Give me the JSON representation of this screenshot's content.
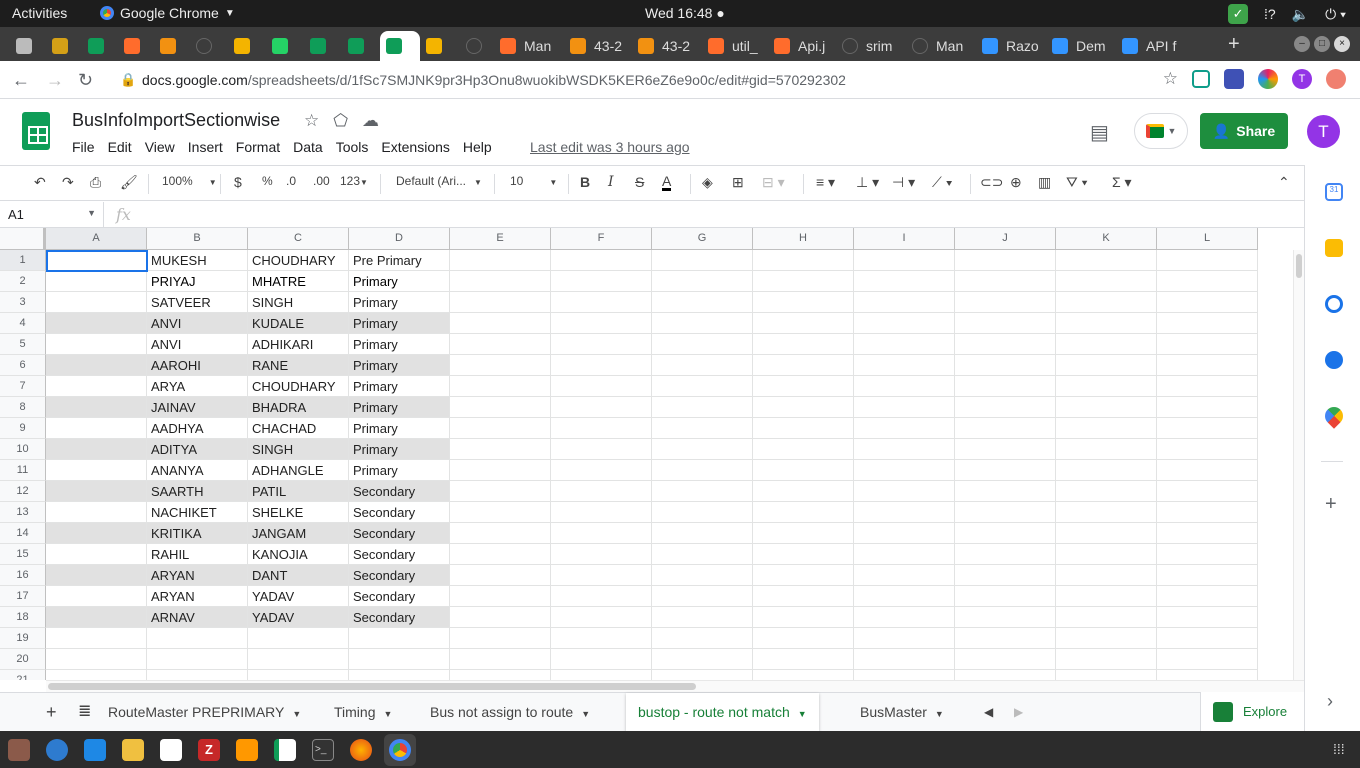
{
  "system": {
    "activities": "Activities",
    "app_name": "Google Chrome",
    "clock": "Wed 16:48 ●"
  },
  "tabs": [
    {
      "label": "",
      "icon": "globe-icon",
      "color": "#bbbbbb"
    },
    {
      "label": "",
      "icon": "moon-icon",
      "color": "#d4a017"
    },
    {
      "label": "",
      "icon": "sheets-icon",
      "color": "#0f9d58"
    },
    {
      "label": "",
      "icon": "cpanel-icon",
      "color": "#ff6c2c"
    },
    {
      "label": "",
      "icon": "pma-icon",
      "color": "#f29111"
    },
    {
      "label": "",
      "icon": "blank-icon",
      "color": "#555555"
    },
    {
      "label": "",
      "icon": "one-icon",
      "color": "#f4b400"
    },
    {
      "label": "",
      "icon": "whatsapp-icon",
      "color": "#25d366"
    },
    {
      "label": "",
      "icon": "sheets-icon",
      "color": "#0f9d58"
    },
    {
      "label": "",
      "icon": "sheets-icon",
      "color": "#0f9d58"
    },
    {
      "label": "",
      "icon": "sheets-icon",
      "color": "#0f9d58"
    },
    {
      "label": "",
      "icon": "one-icon",
      "color": "#f4b400"
    },
    {
      "label": "",
      "icon": "blank-icon",
      "color": "#555555"
    },
    {
      "label": "Man",
      "icon": "cpanel-icon",
      "color": "#ff6c2c"
    },
    {
      "label": "43-2",
      "icon": "pma-icon",
      "color": "#f29111"
    },
    {
      "label": "43-2",
      "icon": "pma-icon",
      "color": "#f29111"
    },
    {
      "label": "util_",
      "icon": "cpanel-icon",
      "color": "#ff6c2c"
    },
    {
      "label": "Api.j",
      "icon": "cpanel-icon",
      "color": "#ff6c2c"
    },
    {
      "label": "srim",
      "icon": "blank-icon",
      "color": "#555555"
    },
    {
      "label": "Man",
      "icon": "blank-icon",
      "color": "#555555"
    },
    {
      "label": "Razo",
      "icon": "razorpay-icon",
      "color": "#3395ff"
    },
    {
      "label": "Dem",
      "icon": "razorpay-icon",
      "color": "#3395ff"
    },
    {
      "label": "API f",
      "icon": "razorpay-icon",
      "color": "#3395ff"
    }
  ],
  "address": {
    "host": "docs.google.com",
    "path": "/spreadsheets/d/1fSc7SMJNK9pr3Hp3Onu8wuokibWSDK5KER6eZ6e9o0c/edit#gid=570292302"
  },
  "doc": {
    "title": "BusInfoImportSectionwise",
    "last_edit": "Last edit was 3 hours ago",
    "share": "Share",
    "avatar": "T"
  },
  "menu": [
    "File",
    "Edit",
    "View",
    "Insert",
    "Format",
    "Data",
    "Tools",
    "Extensions",
    "Help"
  ],
  "toolbar": {
    "zoom": "100%",
    "currency": "$",
    "percent": "%",
    "dec_less": ".0",
    "dec_more": ".00",
    "format": "123",
    "font": "Default (Ari...",
    "font_size": "10"
  },
  "namebox": "A1",
  "fx": "fx",
  "columns": [
    "A",
    "B",
    "C",
    "D",
    "E",
    "F",
    "G",
    "H",
    "I",
    "J",
    "K",
    "L"
  ],
  "rows": [
    {
      "n": "1",
      "b": "MUKESH",
      "c": "CHOUDHARY",
      "d": "Pre Primary",
      "shade": false,
      "bold": false
    },
    {
      "n": "2",
      "b": "PRIYAJ",
      "c": "MHATRE",
      "d": "Primary",
      "shade": false,
      "bold": true
    },
    {
      "n": "3",
      "b": "SATVEER",
      "c": "SINGH",
      "d": "Primary",
      "shade": false,
      "bold": false
    },
    {
      "n": "4",
      "b": "ANVI",
      "c": "KUDALE",
      "d": "Primary",
      "shade": true,
      "bold": false
    },
    {
      "n": "5",
      "b": "ANVI",
      "c": "ADHIKARI",
      "d": "Primary",
      "shade": false,
      "bold": false
    },
    {
      "n": "6",
      "b": "AAROHI",
      "c": "RANE",
      "d": "Primary",
      "shade": true,
      "bold": false
    },
    {
      "n": "7",
      "b": "ARYA",
      "c": "CHOUDHARY",
      "d": "Primary",
      "shade": false,
      "bold": false
    },
    {
      "n": "8",
      "b": "JAINAV",
      "c": "BHADRA",
      "d": "Primary",
      "shade": true,
      "bold": false
    },
    {
      "n": "9",
      "b": "AADHYA",
      "c": "CHACHAD",
      "d": "Primary",
      "shade": false,
      "bold": false
    },
    {
      "n": "10",
      "b": "ADITYA",
      "c": "SINGH",
      "d": "Primary",
      "shade": true,
      "bold": false
    },
    {
      "n": "11",
      "b": "ANANYA",
      "c": "ADHANGLE",
      "d": "Primary",
      "shade": false,
      "bold": false
    },
    {
      "n": "12",
      "b": "SAARTH",
      "c": "PATIL",
      "d": "Secondary",
      "shade": true,
      "bold": false
    },
    {
      "n": "13",
      "b": "NACHIKET",
      "c": "SHELKE",
      "d": "Secondary",
      "shade": false,
      "bold": false
    },
    {
      "n": "14",
      "b": "KRITIKA",
      "c": "JANGAM",
      "d": "Secondary",
      "shade": true,
      "bold": false
    },
    {
      "n": "15",
      "b": "RAHIL",
      "c": "KANOJIA",
      "d": "Secondary",
      "shade": false,
      "bold": false
    },
    {
      "n": "16",
      "b": "ARYAN",
      "c": "DANT",
      "d": "Secondary",
      "shade": true,
      "bold": false
    },
    {
      "n": "17",
      "b": "ARYAN",
      "c": "YADAV",
      "d": "Secondary",
      "shade": false,
      "bold": false
    },
    {
      "n": "18",
      "b": "ARNAV",
      "c": "YADAV",
      "d": "Secondary",
      "shade": true,
      "bold": false
    },
    {
      "n": "19",
      "b": "",
      "c": "",
      "d": "",
      "shade": false,
      "bold": false
    },
    {
      "n": "20",
      "b": "",
      "c": "",
      "d": "",
      "shade": false,
      "bold": false
    },
    {
      "n": "21",
      "b": "",
      "c": "",
      "d": "",
      "shade": false,
      "bold": false
    }
  ],
  "sheet_tabs": [
    {
      "label": "RouteMaster PREPRIMARY",
      "active": false
    },
    {
      "label": "Timing",
      "active": false
    },
    {
      "label": "Bus not assign to route",
      "active": false
    },
    {
      "label": "bustop - route not match",
      "active": true
    },
    {
      "label": "BusMaster",
      "active": false
    }
  ],
  "explore": "Explore"
}
